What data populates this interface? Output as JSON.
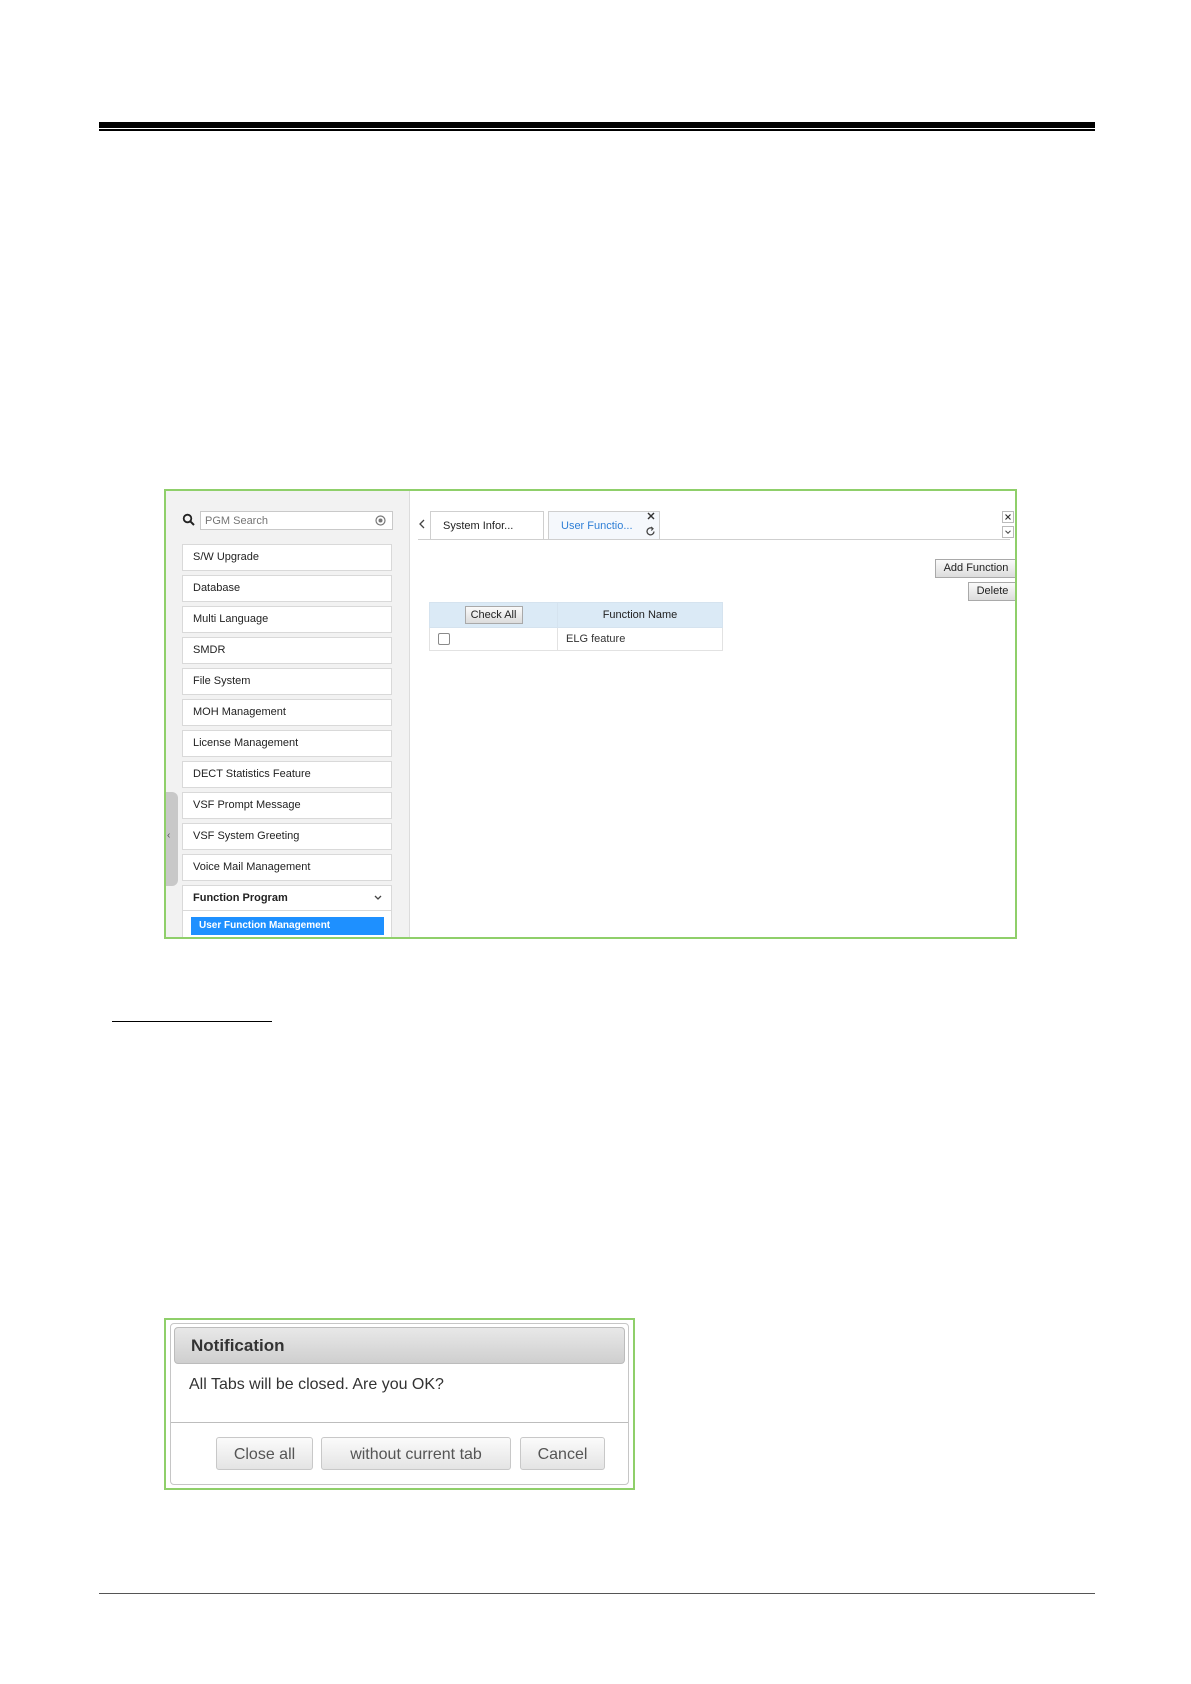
{
  "sidebar": {
    "search_placeholder": "PGM Search",
    "items": [
      {
        "label": "S/W Upgrade"
      },
      {
        "label": "Database"
      },
      {
        "label": "Multi Language"
      },
      {
        "label": "SMDR"
      },
      {
        "label": "File System"
      },
      {
        "label": "MOH Management"
      },
      {
        "label": "License Management"
      },
      {
        "label": "DECT Statistics Feature"
      },
      {
        "label": "VSF Prompt Message"
      },
      {
        "label": "VSF System Greeting"
      },
      {
        "label": "Voice Mail Management"
      },
      {
        "label": "Function Program"
      }
    ],
    "sub_item": "User Function Management",
    "collapse_glyph": "‹"
  },
  "tabs": [
    {
      "label": "System Infor..."
    },
    {
      "label": "User Functio..."
    }
  ],
  "toolbar": {
    "add_label": "Add Function",
    "delete_label": "Delete"
  },
  "table": {
    "check_all_label": "Check All",
    "col_function_name": "Function Name",
    "rows": [
      {
        "name": "ELG feature",
        "checked": false
      }
    ]
  },
  "dialog": {
    "title": "Notification",
    "message": "All Tabs will be closed. Are you OK?",
    "buttons": {
      "close_all": "Close all",
      "without_current": "without current tab",
      "cancel": "Cancel"
    }
  },
  "colors": {
    "frame_border": "#8fcf6a",
    "active_tab": "#2f7fd6",
    "selected_menu": "#1e90ff",
    "table_header": "#dbeaf6"
  }
}
